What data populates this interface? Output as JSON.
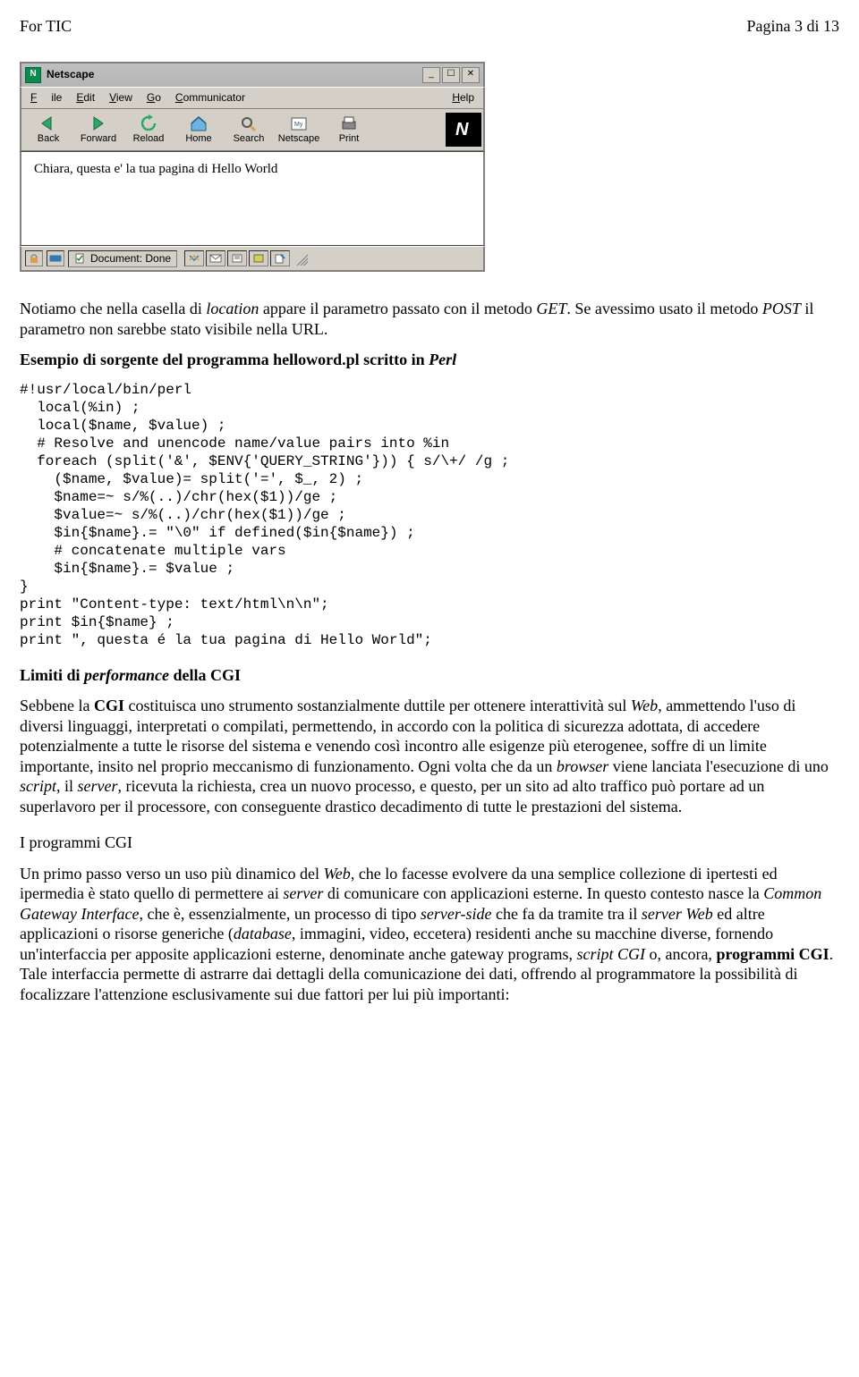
{
  "header": {
    "left": "For TIC",
    "right": "Pagina 3 di 13"
  },
  "browser": {
    "app_name": "Netscape",
    "app_icon_letter": "N",
    "win_min": "_",
    "win_max": "☐",
    "win_close": "✕",
    "menu": {
      "file": "File",
      "edit": "Edit",
      "view": "View",
      "go": "Go",
      "communicator": "Communicator",
      "help": "Help"
    },
    "toolbar": {
      "back": "Back",
      "forward": "Forward",
      "reload": "Reload",
      "home": "Home",
      "search": "Search",
      "netscape": "Netscape",
      "print": "Print",
      "logo_letter": "N"
    },
    "page_text": "Chiara, questa e' la tua pagina di Hello World",
    "status": {
      "label": "Document: Done"
    }
  },
  "para1_a": "Notiamo che nella casella di ",
  "para1_b": "location",
  "para1_c": " appare il parametro passato con il metodo ",
  "para1_d": "GET",
  "para1_e": ". Se avessimo usato il metodo ",
  "para1_f": "POST",
  "para1_g": " il parametro non sarebbe stato visibile nella URL.",
  "para2_a": "Esempio di sorgente del programma helloword.pl scritto in ",
  "para2_b": "Perl",
  "code": "#!usr/local/bin/perl\n  local(%in) ;\n  local($name, $value) ;\n  # Resolve and unencode name/value pairs into %in\n  foreach (split('&', $ENV{'QUERY_STRING'})) { s/\\+/ /g ;\n    ($name, $value)= split('=', $_, 2) ;\n    $name=~ s/%(..)/chr(hex($1))/ge ;\n    $value=~ s/%(..)/chr(hex($1))/ge ;\n    $in{$name}.= \"\\0\" if defined($in{$name}) ;\n    # concatenate multiple vars\n    $in{$name}.= $value ;\n}\nprint \"Content-type: text/html\\n\\n\";\nprint $in{$name} ;\nprint \", questa é la tua pagina di Hello World\";",
  "h_limiti_a": "Limiti di ",
  "h_limiti_b": "performance",
  "h_limiti_c": " della CGI",
  "para3_a": "Sebbene la ",
  "para3_b": "CGI",
  "para3_c": " costituisca uno strumento sostanzialmente duttile per ottenere interattività sul ",
  "para3_d": "Web",
  "para3_e": ", ammettendo l'uso di diversi linguaggi, interpretati o compilati, permettendo, in accordo con la politica di sicurezza adottata, di accedere potenzialmente a tutte le risorse del sistema e venendo così incontro alle esigenze più eterogenee, soffre di un limite importante, insito nel proprio meccanismo di funzionamento. Ogni volta che da un ",
  "para3_f": "browser",
  "para3_g": " viene lanciata l'esecuzione di uno ",
  "para3_h": "script",
  "para3_i": ", il ",
  "para3_j": "server",
  "para3_k": ", ricevuta la richiesta, crea un nuovo processo, e questo, per un sito ad alto traffico può portare ad un superlavoro per il processore, con conseguente drastico decadimento di tutte le prestazioni del sistema.",
  "h_prog": "I programmi CGI",
  "para4_a": "Un primo passo verso un uso più dinamico del ",
  "para4_b": "Web",
  "para4_c": ", che lo facesse evolvere da una semplice collezione di ipertesti ed ipermedia è stato quello di permettere ai ",
  "para4_d": "server",
  "para4_e": " di comunicare con applicazioni esterne. In questo contesto nasce la ",
  "para4_f": "Common Gateway Interface",
  "para4_g": ", che è, essenzialmente, un processo di tipo ",
  "para4_h": "server-side",
  "para4_i": " che fa da tramite tra il ",
  "para4_j": "server Web",
  "para4_k": " ed altre applicazioni o risorse generiche (",
  "para4_l": "database",
  "para4_m": ", immagini, video, eccetera) residenti anche su macchine diverse, fornendo un'interfaccia per apposite applicazioni esterne, denominate anche gateway programs, ",
  "para4_n": "script CGI",
  "para4_o": " o, ancora, ",
  "para4_p": "programmi CGI",
  "para4_q": ". Tale interfaccia permette di astrarre dai dettagli della comunicazione dei dati, offrendo al programmatore la possibilità di focalizzare l'attenzione esclusivamente sui due fattori per lui più importanti:"
}
